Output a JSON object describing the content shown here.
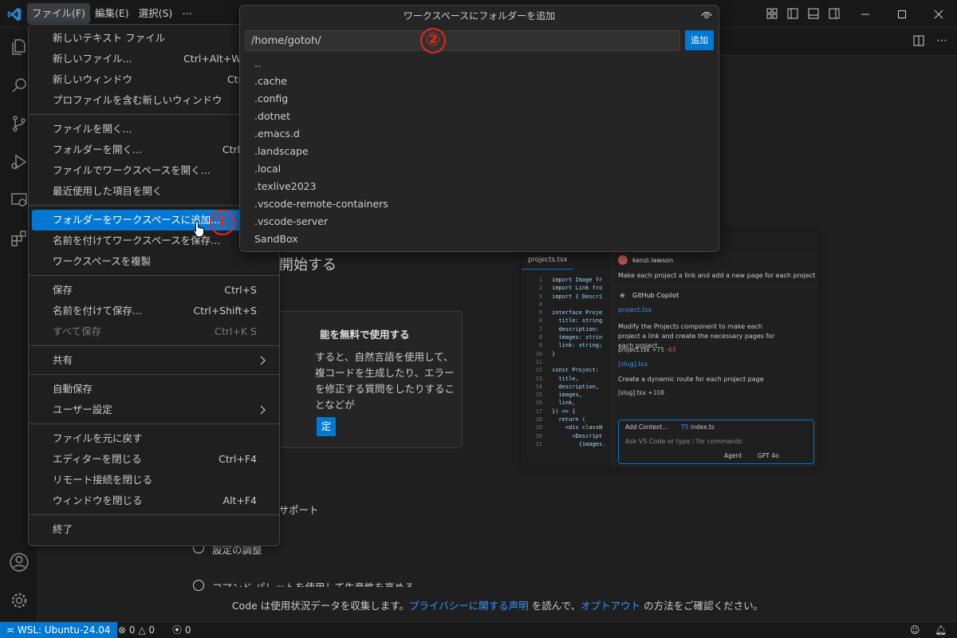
{
  "menubar": {
    "items": [
      "ファイル(F)",
      "編集(E)",
      "選択(S)",
      "⋯"
    ]
  },
  "file_menu": {
    "groups": [
      [
        {
          "label": "新しいテキスト ファイル",
          "shortcut": "Ctrl"
        },
        {
          "label": "新しいファイル...",
          "shortcut": "Ctrl+Alt+Windows"
        },
        {
          "label": "新しいウィンドウ",
          "shortcut": "Ctrl+Shift"
        },
        {
          "label": "プロファイルを含む新しいウィンドウ",
          "shortcut": ""
        }
      ],
      [
        {
          "label": "ファイルを開く...",
          "shortcut": "Ctrl"
        },
        {
          "label": "フォルダーを開く...",
          "shortcut": "Ctrl+K Ctrl"
        },
        {
          "label": "ファイルでワークスペースを開く...",
          "shortcut": ""
        },
        {
          "label": "最近使用した項目を開く",
          "shortcut": ""
        }
      ],
      [
        {
          "label": "フォルダーをワークスペースに追加...",
          "shortcut": "",
          "highlighted": true
        },
        {
          "label": "名前を付けてワークスペースを保存...",
          "shortcut": ""
        },
        {
          "label": "ワークスペースを複製",
          "shortcut": ""
        }
      ],
      [
        {
          "label": "保存",
          "shortcut": "Ctrl+S"
        },
        {
          "label": "名前を付けて保存...",
          "shortcut": "Ctrl+Shift+S"
        },
        {
          "label": "すべて保存",
          "shortcut": "Ctrl+K S",
          "disabled": true
        }
      ],
      [
        {
          "label": "共有",
          "shortcut": "",
          "submenu": true
        }
      ],
      [
        {
          "label": "自動保存",
          "shortcut": ""
        },
        {
          "label": "ユーザー設定",
          "shortcut": "",
          "submenu": true
        }
      ],
      [
        {
          "label": "ファイルを元に戻す",
          "shortcut": ""
        },
        {
          "label": "エディターを閉じる",
          "shortcut": "Ctrl+F4"
        },
        {
          "label": "リモート接続を閉じる",
          "shortcut": ""
        },
        {
          "label": "ウィンドウを閉じる",
          "shortcut": "Alt+F4"
        }
      ],
      [
        {
          "label": "終了",
          "shortcut": ""
        }
      ]
    ]
  },
  "quick_pick": {
    "title": "ワークスペースにフォルダーを追加",
    "input_value": "/home/gotoh/",
    "ok_label": "追加",
    "items": [
      "..",
      ".cache",
      ".config",
      ".dotnet",
      ".emacs.d",
      ".landscape",
      ".local",
      ".texlive2023",
      ".vscode-remote-containers",
      ".vscode-server",
      "SandBox"
    ]
  },
  "annotations": {
    "one": "①",
    "two": "②"
  },
  "welcome": {
    "start_heading": "開始する",
    "copilot_title": "能を無料で使用する",
    "copilot_desc": "すると、自然言語を使用して、複コードを生成したり、エラーを修正する質問をしたりすることなどが",
    "copilot_button": "定",
    "walk_1": "豊富なサポート",
    "walk_2": "設定の調整",
    "walk_3": "コマンド パレットを使用して生産性を高める"
  },
  "preview": {
    "tab": "projects.tsx",
    "gutter": "1\n2\n3\n4\n5\n6\n7\n8\n9\n10\n11\n12\n13\n14\n15\n16\n17\n18\n19\n20\n21",
    "code": "import Image fr\nimport Link fro\nimport { Descri\n\ninterface Proje\n  title: string\n  description:\n  images: strin\n  link: string;\n}\n\nconst Project:\n  title,\n  description,\n  images,\n  link,\n}) => {\n  return (\n    <div classN\n      <Descript\n        {images.",
    "user": "kenzi.lawson",
    "user_msg": "Make each project a link and add a new page for each project",
    "assistant": "GitHub Copilot",
    "file1": "project.tsx",
    "msg1": "Modify the Projects component to make each project a link and create the necessary pages for each project.",
    "chip1": "project.tsx",
    "chip1_add": "+75",
    "chip1_del": "-63",
    "file2": "[slug].tsx",
    "msg2": "Create a dynamic route for each project page",
    "chip2": "[slug].tsx",
    "chip2_add": "+108",
    "ctx_chip": "Add Context...",
    "ctx_file": "index.ts",
    "ctx_file_tag": "TS",
    "input_placeholder": "Ask VS Code or type / for commands",
    "mode": "Agent",
    "model": "GPT 4o"
  },
  "privacy": {
    "pre": "Code は使用状況データを収集します。",
    "link1": "プライバシーに関する声明",
    "mid": " を読んで、",
    "link2": "オプトアウト",
    "post": " の方法をご確認ください。"
  },
  "statusbar": {
    "remote": "WSL: Ubuntu-24.04",
    "errors": "0",
    "warnings": "0",
    "ports": "0"
  },
  "colors": {
    "accent": "#0078d4",
    "annotation": "#e8271a",
    "background": "#1f1f1f"
  }
}
